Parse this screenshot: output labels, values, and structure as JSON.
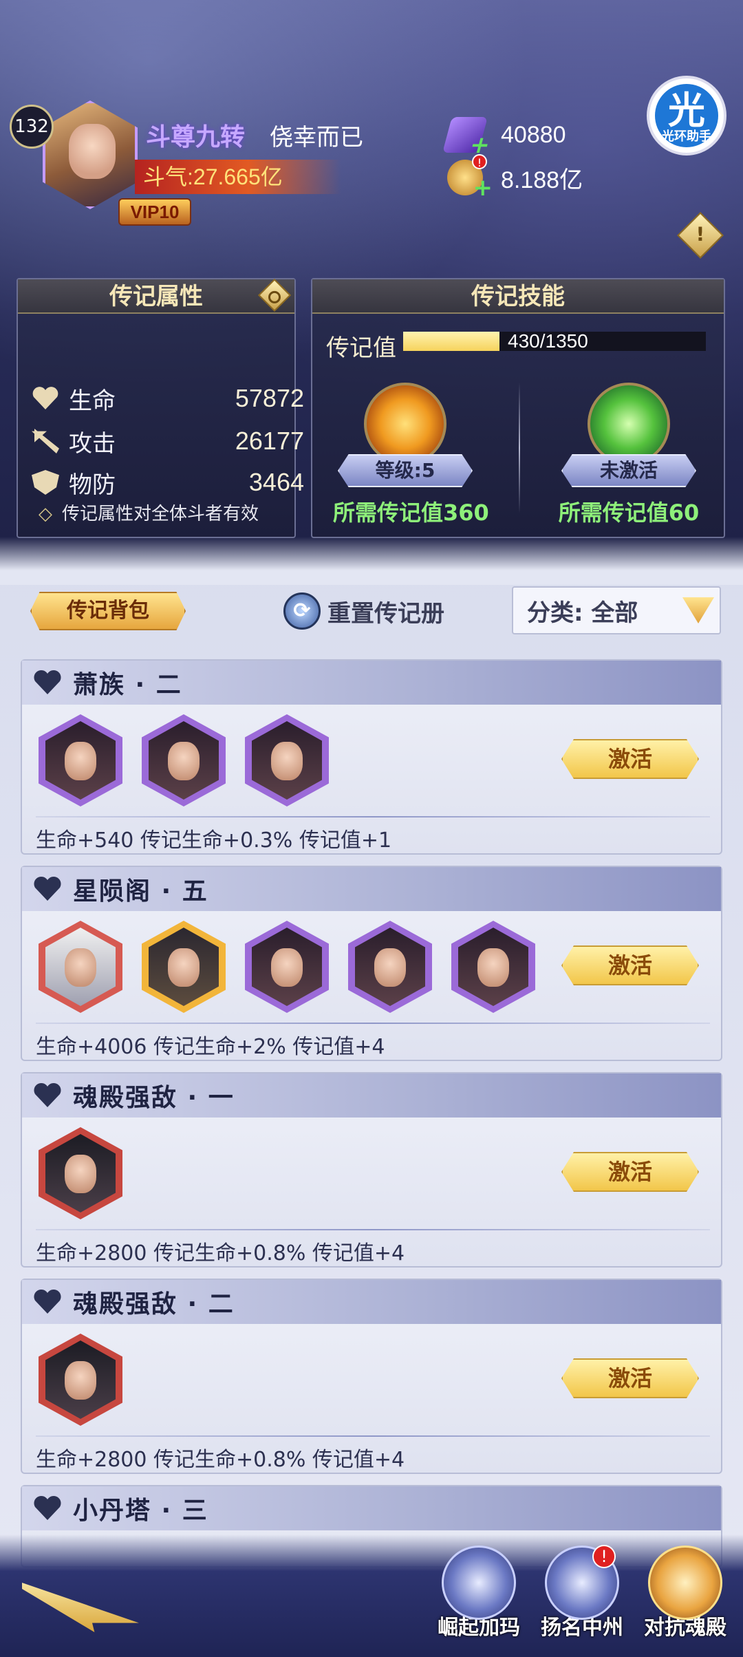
{
  "header": {
    "player_level": "132",
    "vip_label": "VIP10",
    "title": "斗尊九转",
    "name": "侥幸而已",
    "power": "斗气:27.665亿",
    "resources": [
      {
        "icon": "purple-gem-icon",
        "value": "40880",
        "alert": ""
      },
      {
        "icon": "gold-coin-icon",
        "value": "8.188亿",
        "alert": "!"
      }
    ],
    "helper": {
      "glyph": "光",
      "label": "光环助手"
    },
    "info_glyph": "!"
  },
  "attributes_panel": {
    "title": "传记属性",
    "rows": [
      {
        "icon": "heart-icon",
        "label": "生命",
        "value": "57872"
      },
      {
        "icon": "sword-icon",
        "label": "攻击",
        "value": "26177"
      },
      {
        "icon": "shield-icon",
        "label": "物防",
        "value": "3464"
      }
    ],
    "note": "传记属性对全体斗者有效"
  },
  "skills_panel": {
    "title": "传记技能",
    "progress_label": "传记值",
    "progress_text": "430/1350",
    "progress_value": 430,
    "progress_max": 1350,
    "skills": [
      {
        "icon": "flame-skill-icon",
        "status": "等级:5",
        "requirement": "所需传记值360"
      },
      {
        "icon": "heal-skill-icon",
        "status": "未激活",
        "requirement": "所需传记值60"
      }
    ]
  },
  "toolbar": {
    "backpack_label": "传记背包",
    "reset_label": "重置传记册",
    "category_label": "分类: 全部"
  },
  "cards": [
    {
      "title": "萧族 · 二",
      "heroes": [
        "purple",
        "purple",
        "purple"
      ],
      "button": "激活",
      "bonus": "生命+540  传记生命+0.3%  传记值+1"
    },
    {
      "title": "星陨阁 · 五",
      "heroes": [
        "red",
        "gold",
        "purple",
        "purple",
        "purple"
      ],
      "button": "激活",
      "bonus": "生命+4006  传记生命+2%  传记值+4"
    },
    {
      "title": "魂殿强敌 · 一",
      "heroes": [
        "red2"
      ],
      "button": "激活",
      "bonus": "生命+2800  传记生命+0.8%  传记值+4"
    },
    {
      "title": "魂殿强敌 · 二",
      "heroes": [
        "red2"
      ],
      "button": "激活",
      "bonus": "生命+2800  传记生命+0.8%  传记值+4"
    },
    {
      "title": "小丹塔 · 三"
    }
  ],
  "bottom_nav": [
    {
      "label": "崛起加玛",
      "alert": ""
    },
    {
      "label": "扬名中州",
      "alert": "!"
    },
    {
      "label": "对抗魂殿",
      "alert": ""
    }
  ]
}
